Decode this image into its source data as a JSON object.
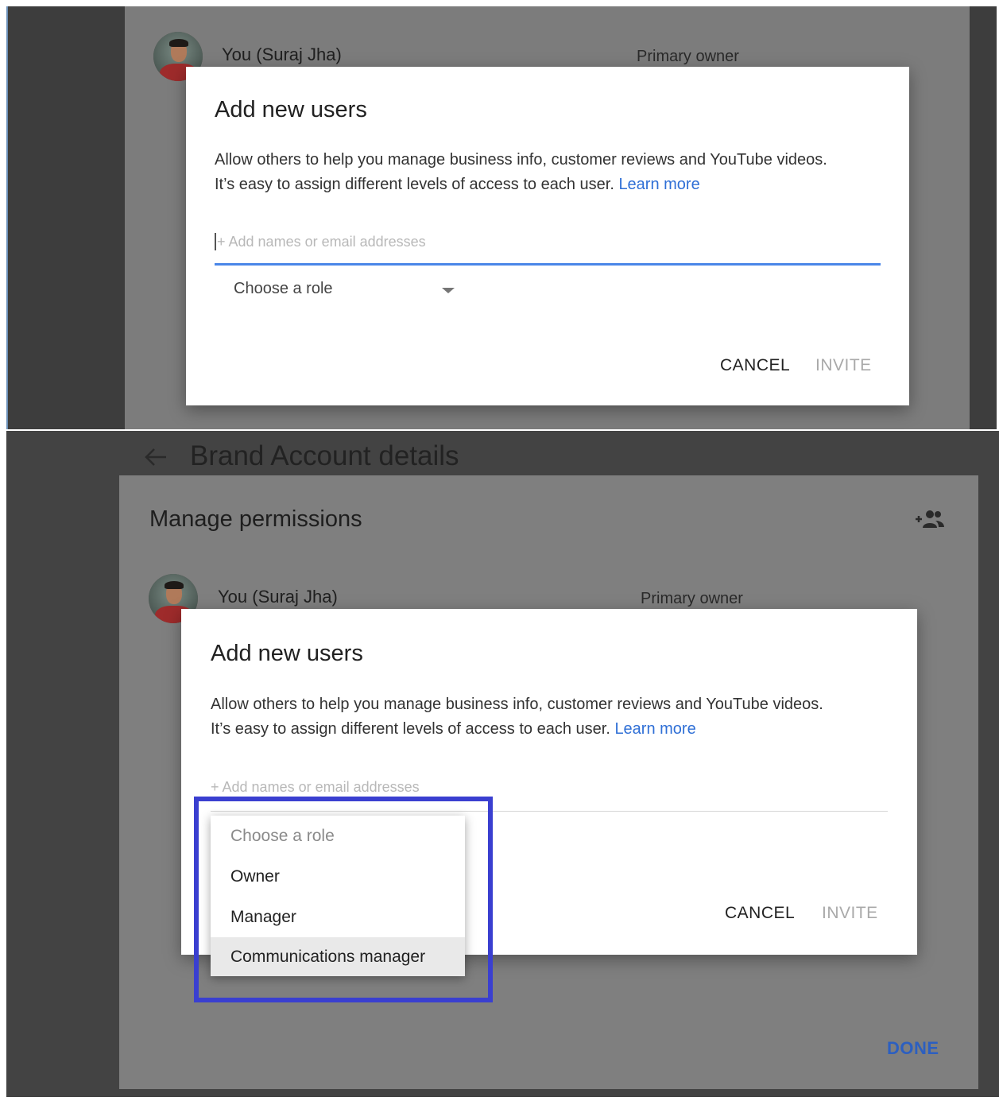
{
  "top_panel": {
    "owner_row": {
      "name": "You (Suraj Jha)",
      "role": "Primary owner"
    },
    "dialog": {
      "title": "Add new users",
      "body_line1": "Allow others to help you manage business info, customer reviews and YouTube videos.",
      "body_line2": "It’s easy to assign different levels of access to each user.",
      "learn_more": "Learn more",
      "input_placeholder": "+ Add names or email addresses",
      "role_select": "Choose a role",
      "cancel_label": "CANCEL",
      "invite_label": "INVITE"
    }
  },
  "bottom_panel": {
    "header": {
      "title": "Brand Account details",
      "back_icon": "arrow-left-icon"
    },
    "section": {
      "title": "Manage permissions",
      "add_user_icon": "person-add-icon"
    },
    "owner_row": {
      "name": "You (Suraj Jha)",
      "role": "Primary owner"
    },
    "dialog": {
      "title": "Add new users",
      "body_line1": "Allow others to help you manage business info, customer reviews and YouTube videos.",
      "body_line2": "It’s easy to assign different levels of access to each user.",
      "learn_more": "Learn more",
      "input_placeholder": "+ Add names or email addresses",
      "cancel_label": "CANCEL",
      "invite_label": "INVITE"
    },
    "role_menu": {
      "items": [
        "Choose a role",
        "Owner",
        "Manager",
        "Communications manager"
      ],
      "selected": "Communications manager"
    },
    "done_label": "DONE"
  },
  "colors": {
    "accent_blue": "#2f6fd6",
    "highlight_box": "#3a3fd0",
    "overlay_dark": "#3d3d3d",
    "overlay_card": "#7c7c7c"
  }
}
